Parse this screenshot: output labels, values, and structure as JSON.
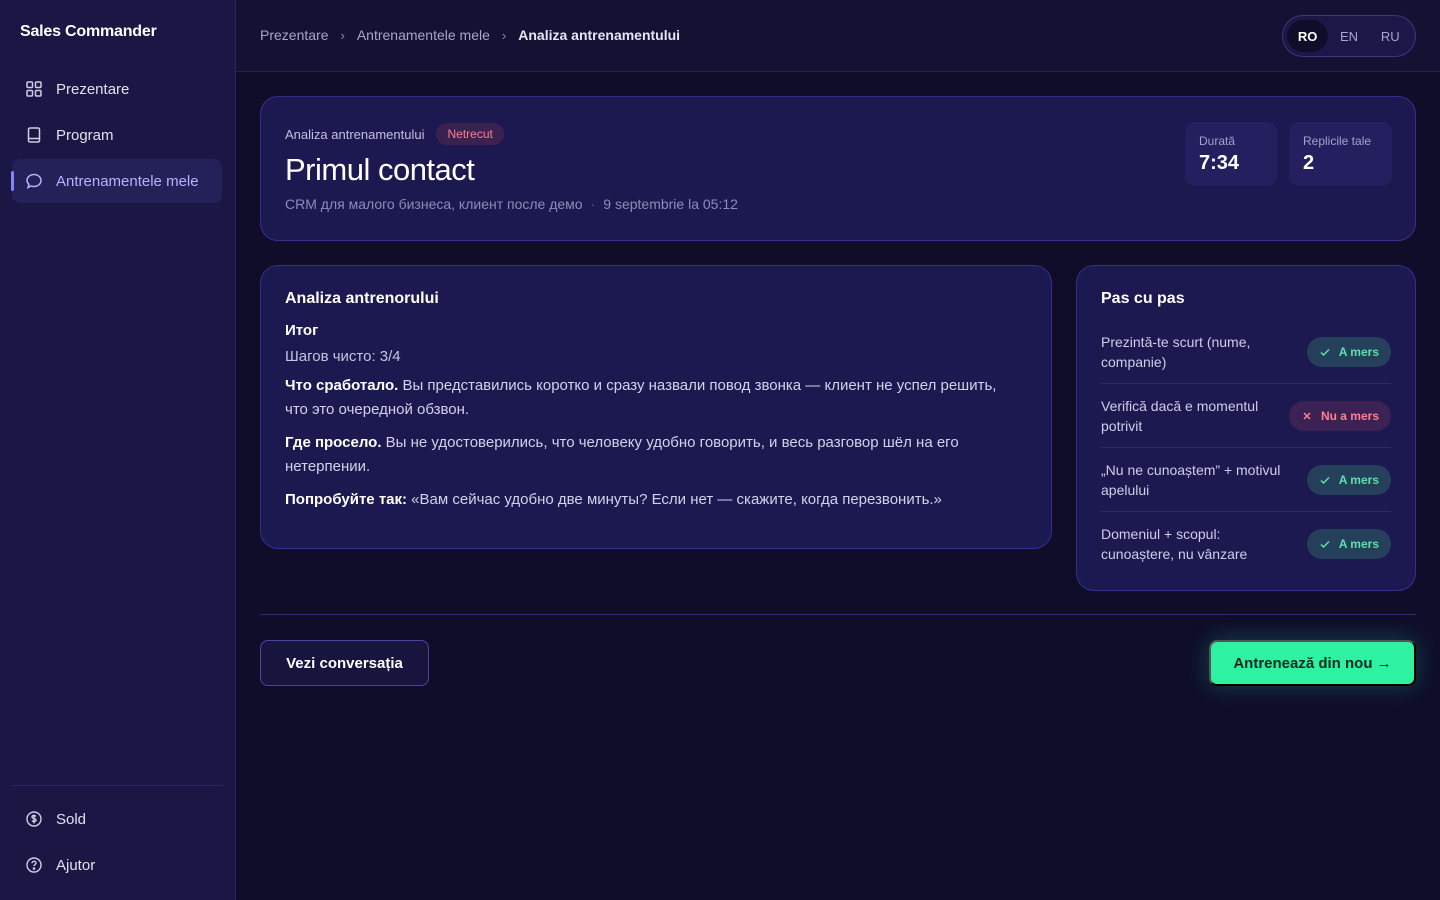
{
  "app": {
    "name": "Sales Commander"
  },
  "sidebar": {
    "items": [
      {
        "label": "Prezentare",
        "icon": "grid-icon"
      },
      {
        "label": "Program",
        "icon": "book-icon"
      },
      {
        "label": "Antrenamentele mele",
        "icon": "chat-bubble-icon",
        "active": true
      }
    ],
    "bottom_items": [
      {
        "label": "Sold",
        "icon": "dollar-circle-icon"
      },
      {
        "label": "Ajutor",
        "icon": "help-circle-icon"
      }
    ]
  },
  "breadcrumb": [
    "Prezentare",
    "Antrenamentele mele",
    "Analiza antrenamentului"
  ],
  "languages": {
    "options": [
      "RO",
      "EN",
      "RU"
    ],
    "selected": "RO"
  },
  "header": {
    "label": "Analiza antrenamentului",
    "status": "Netrecut",
    "title": "Primul contact",
    "scenario": "CRM для малого бизнеса, клиент после демо",
    "date": "9 septembrie la 05:12",
    "stats": [
      {
        "label": "Durată",
        "value": "7:34"
      },
      {
        "label": "Replicile tale",
        "value": "2"
      }
    ]
  },
  "analysis": {
    "title": "Analiza antrenorului",
    "summary_heading": "Итог",
    "steps_line": "Шагов чисто: 3/4",
    "worked_label": "Что сработало.",
    "worked_text": " Вы представились коротко и сразу назвали повод звонка — клиент не успел решить, что это очередной обзвон.",
    "failed_label": "Где просело.",
    "failed_text": " Вы не удостоверились, что человеку удобно говорить, и весь разговор шёл на его нетерпении.",
    "try_label": "Попробуйте так:",
    "try_text": " «Вам сейчас удобно две минуты? Если нет — скажите, когда перезвонить.»"
  },
  "steps": {
    "title": "Pas cu pas",
    "items": [
      {
        "text": "Prezintă-te scurt (nume, companie)",
        "status": "A mers",
        "passed": true
      },
      {
        "text": "Verifică dacă e momentul potrivit",
        "status": "Nu a mers",
        "passed": false
      },
      {
        "text": "„Nu ne cunoaștem” + motivul apelului",
        "status": "A mers",
        "passed": true
      },
      {
        "text": "Domeniul + scopul: cunoaștere, nu vânzare",
        "status": "A mers",
        "passed": true
      }
    ]
  },
  "actions": {
    "view_conversation": "Vezi conversația",
    "retrain": "Antrenează din nou →"
  },
  "colors": {
    "accent": "#2cf2a2",
    "nav_active": "#b9b2ff",
    "fail": "#ff7f8c",
    "success": "#5fe0a8",
    "background": "#0f0d2a"
  }
}
